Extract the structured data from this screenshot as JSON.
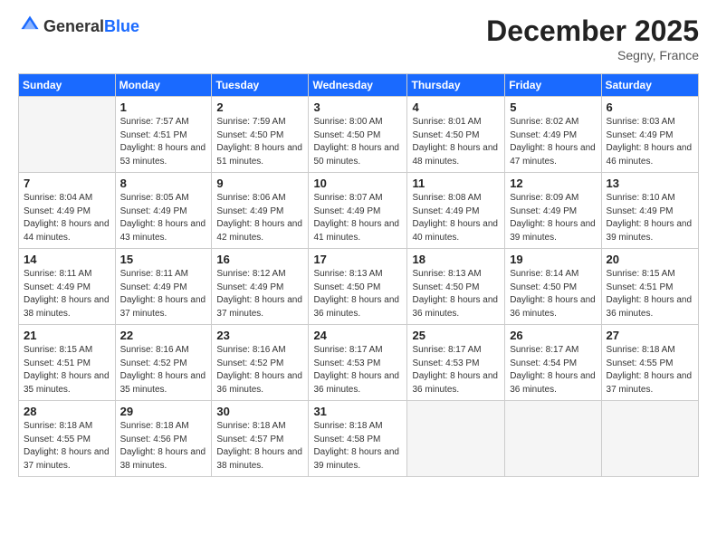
{
  "logo": {
    "general": "General",
    "blue": "Blue"
  },
  "title": "December 2025",
  "location": "Segny, France",
  "header_row": [
    "Sunday",
    "Monday",
    "Tuesday",
    "Wednesday",
    "Thursday",
    "Friday",
    "Saturday"
  ],
  "weeks": [
    [
      {
        "day": "",
        "empty": true
      },
      {
        "day": "1",
        "sunrise": "Sunrise: 7:57 AM",
        "sunset": "Sunset: 4:51 PM",
        "daylight": "Daylight: 8 hours and 53 minutes."
      },
      {
        "day": "2",
        "sunrise": "Sunrise: 7:59 AM",
        "sunset": "Sunset: 4:50 PM",
        "daylight": "Daylight: 8 hours and 51 minutes."
      },
      {
        "day": "3",
        "sunrise": "Sunrise: 8:00 AM",
        "sunset": "Sunset: 4:50 PM",
        "daylight": "Daylight: 8 hours and 50 minutes."
      },
      {
        "day": "4",
        "sunrise": "Sunrise: 8:01 AM",
        "sunset": "Sunset: 4:50 PM",
        "daylight": "Daylight: 8 hours and 48 minutes."
      },
      {
        "day": "5",
        "sunrise": "Sunrise: 8:02 AM",
        "sunset": "Sunset: 4:49 PM",
        "daylight": "Daylight: 8 hours and 47 minutes."
      },
      {
        "day": "6",
        "sunrise": "Sunrise: 8:03 AM",
        "sunset": "Sunset: 4:49 PM",
        "daylight": "Daylight: 8 hours and 46 minutes."
      }
    ],
    [
      {
        "day": "7",
        "sunrise": "Sunrise: 8:04 AM",
        "sunset": "Sunset: 4:49 PM",
        "daylight": "Daylight: 8 hours and 44 minutes."
      },
      {
        "day": "8",
        "sunrise": "Sunrise: 8:05 AM",
        "sunset": "Sunset: 4:49 PM",
        "daylight": "Daylight: 8 hours and 43 minutes."
      },
      {
        "day": "9",
        "sunrise": "Sunrise: 8:06 AM",
        "sunset": "Sunset: 4:49 PM",
        "daylight": "Daylight: 8 hours and 42 minutes."
      },
      {
        "day": "10",
        "sunrise": "Sunrise: 8:07 AM",
        "sunset": "Sunset: 4:49 PM",
        "daylight": "Daylight: 8 hours and 41 minutes."
      },
      {
        "day": "11",
        "sunrise": "Sunrise: 8:08 AM",
        "sunset": "Sunset: 4:49 PM",
        "daylight": "Daylight: 8 hours and 40 minutes."
      },
      {
        "day": "12",
        "sunrise": "Sunrise: 8:09 AM",
        "sunset": "Sunset: 4:49 PM",
        "daylight": "Daylight: 8 hours and 39 minutes."
      },
      {
        "day": "13",
        "sunrise": "Sunrise: 8:10 AM",
        "sunset": "Sunset: 4:49 PM",
        "daylight": "Daylight: 8 hours and 39 minutes."
      }
    ],
    [
      {
        "day": "14",
        "sunrise": "Sunrise: 8:11 AM",
        "sunset": "Sunset: 4:49 PM",
        "daylight": "Daylight: 8 hours and 38 minutes."
      },
      {
        "day": "15",
        "sunrise": "Sunrise: 8:11 AM",
        "sunset": "Sunset: 4:49 PM",
        "daylight": "Daylight: 8 hours and 37 minutes."
      },
      {
        "day": "16",
        "sunrise": "Sunrise: 8:12 AM",
        "sunset": "Sunset: 4:49 PM",
        "daylight": "Daylight: 8 hours and 37 minutes."
      },
      {
        "day": "17",
        "sunrise": "Sunrise: 8:13 AM",
        "sunset": "Sunset: 4:50 PM",
        "daylight": "Daylight: 8 hours and 36 minutes."
      },
      {
        "day": "18",
        "sunrise": "Sunrise: 8:13 AM",
        "sunset": "Sunset: 4:50 PM",
        "daylight": "Daylight: 8 hours and 36 minutes."
      },
      {
        "day": "19",
        "sunrise": "Sunrise: 8:14 AM",
        "sunset": "Sunset: 4:50 PM",
        "daylight": "Daylight: 8 hours and 36 minutes."
      },
      {
        "day": "20",
        "sunrise": "Sunrise: 8:15 AM",
        "sunset": "Sunset: 4:51 PM",
        "daylight": "Daylight: 8 hours and 36 minutes."
      }
    ],
    [
      {
        "day": "21",
        "sunrise": "Sunrise: 8:15 AM",
        "sunset": "Sunset: 4:51 PM",
        "daylight": "Daylight: 8 hours and 35 minutes."
      },
      {
        "day": "22",
        "sunrise": "Sunrise: 8:16 AM",
        "sunset": "Sunset: 4:52 PM",
        "daylight": "Daylight: 8 hours and 35 minutes."
      },
      {
        "day": "23",
        "sunrise": "Sunrise: 8:16 AM",
        "sunset": "Sunset: 4:52 PM",
        "daylight": "Daylight: 8 hours and 36 minutes."
      },
      {
        "day": "24",
        "sunrise": "Sunrise: 8:17 AM",
        "sunset": "Sunset: 4:53 PM",
        "daylight": "Daylight: 8 hours and 36 minutes."
      },
      {
        "day": "25",
        "sunrise": "Sunrise: 8:17 AM",
        "sunset": "Sunset: 4:53 PM",
        "daylight": "Daylight: 8 hours and 36 minutes."
      },
      {
        "day": "26",
        "sunrise": "Sunrise: 8:17 AM",
        "sunset": "Sunset: 4:54 PM",
        "daylight": "Daylight: 8 hours and 36 minutes."
      },
      {
        "day": "27",
        "sunrise": "Sunrise: 8:18 AM",
        "sunset": "Sunset: 4:55 PM",
        "daylight": "Daylight: 8 hours and 37 minutes."
      }
    ],
    [
      {
        "day": "28",
        "sunrise": "Sunrise: 8:18 AM",
        "sunset": "Sunset: 4:55 PM",
        "daylight": "Daylight: 8 hours and 37 minutes."
      },
      {
        "day": "29",
        "sunrise": "Sunrise: 8:18 AM",
        "sunset": "Sunset: 4:56 PM",
        "daylight": "Daylight: 8 hours and 38 minutes."
      },
      {
        "day": "30",
        "sunrise": "Sunrise: 8:18 AM",
        "sunset": "Sunset: 4:57 PM",
        "daylight": "Daylight: 8 hours and 38 minutes."
      },
      {
        "day": "31",
        "sunrise": "Sunrise: 8:18 AM",
        "sunset": "Sunset: 4:58 PM",
        "daylight": "Daylight: 8 hours and 39 minutes."
      },
      {
        "day": "",
        "empty": true
      },
      {
        "day": "",
        "empty": true
      },
      {
        "day": "",
        "empty": true
      }
    ]
  ]
}
